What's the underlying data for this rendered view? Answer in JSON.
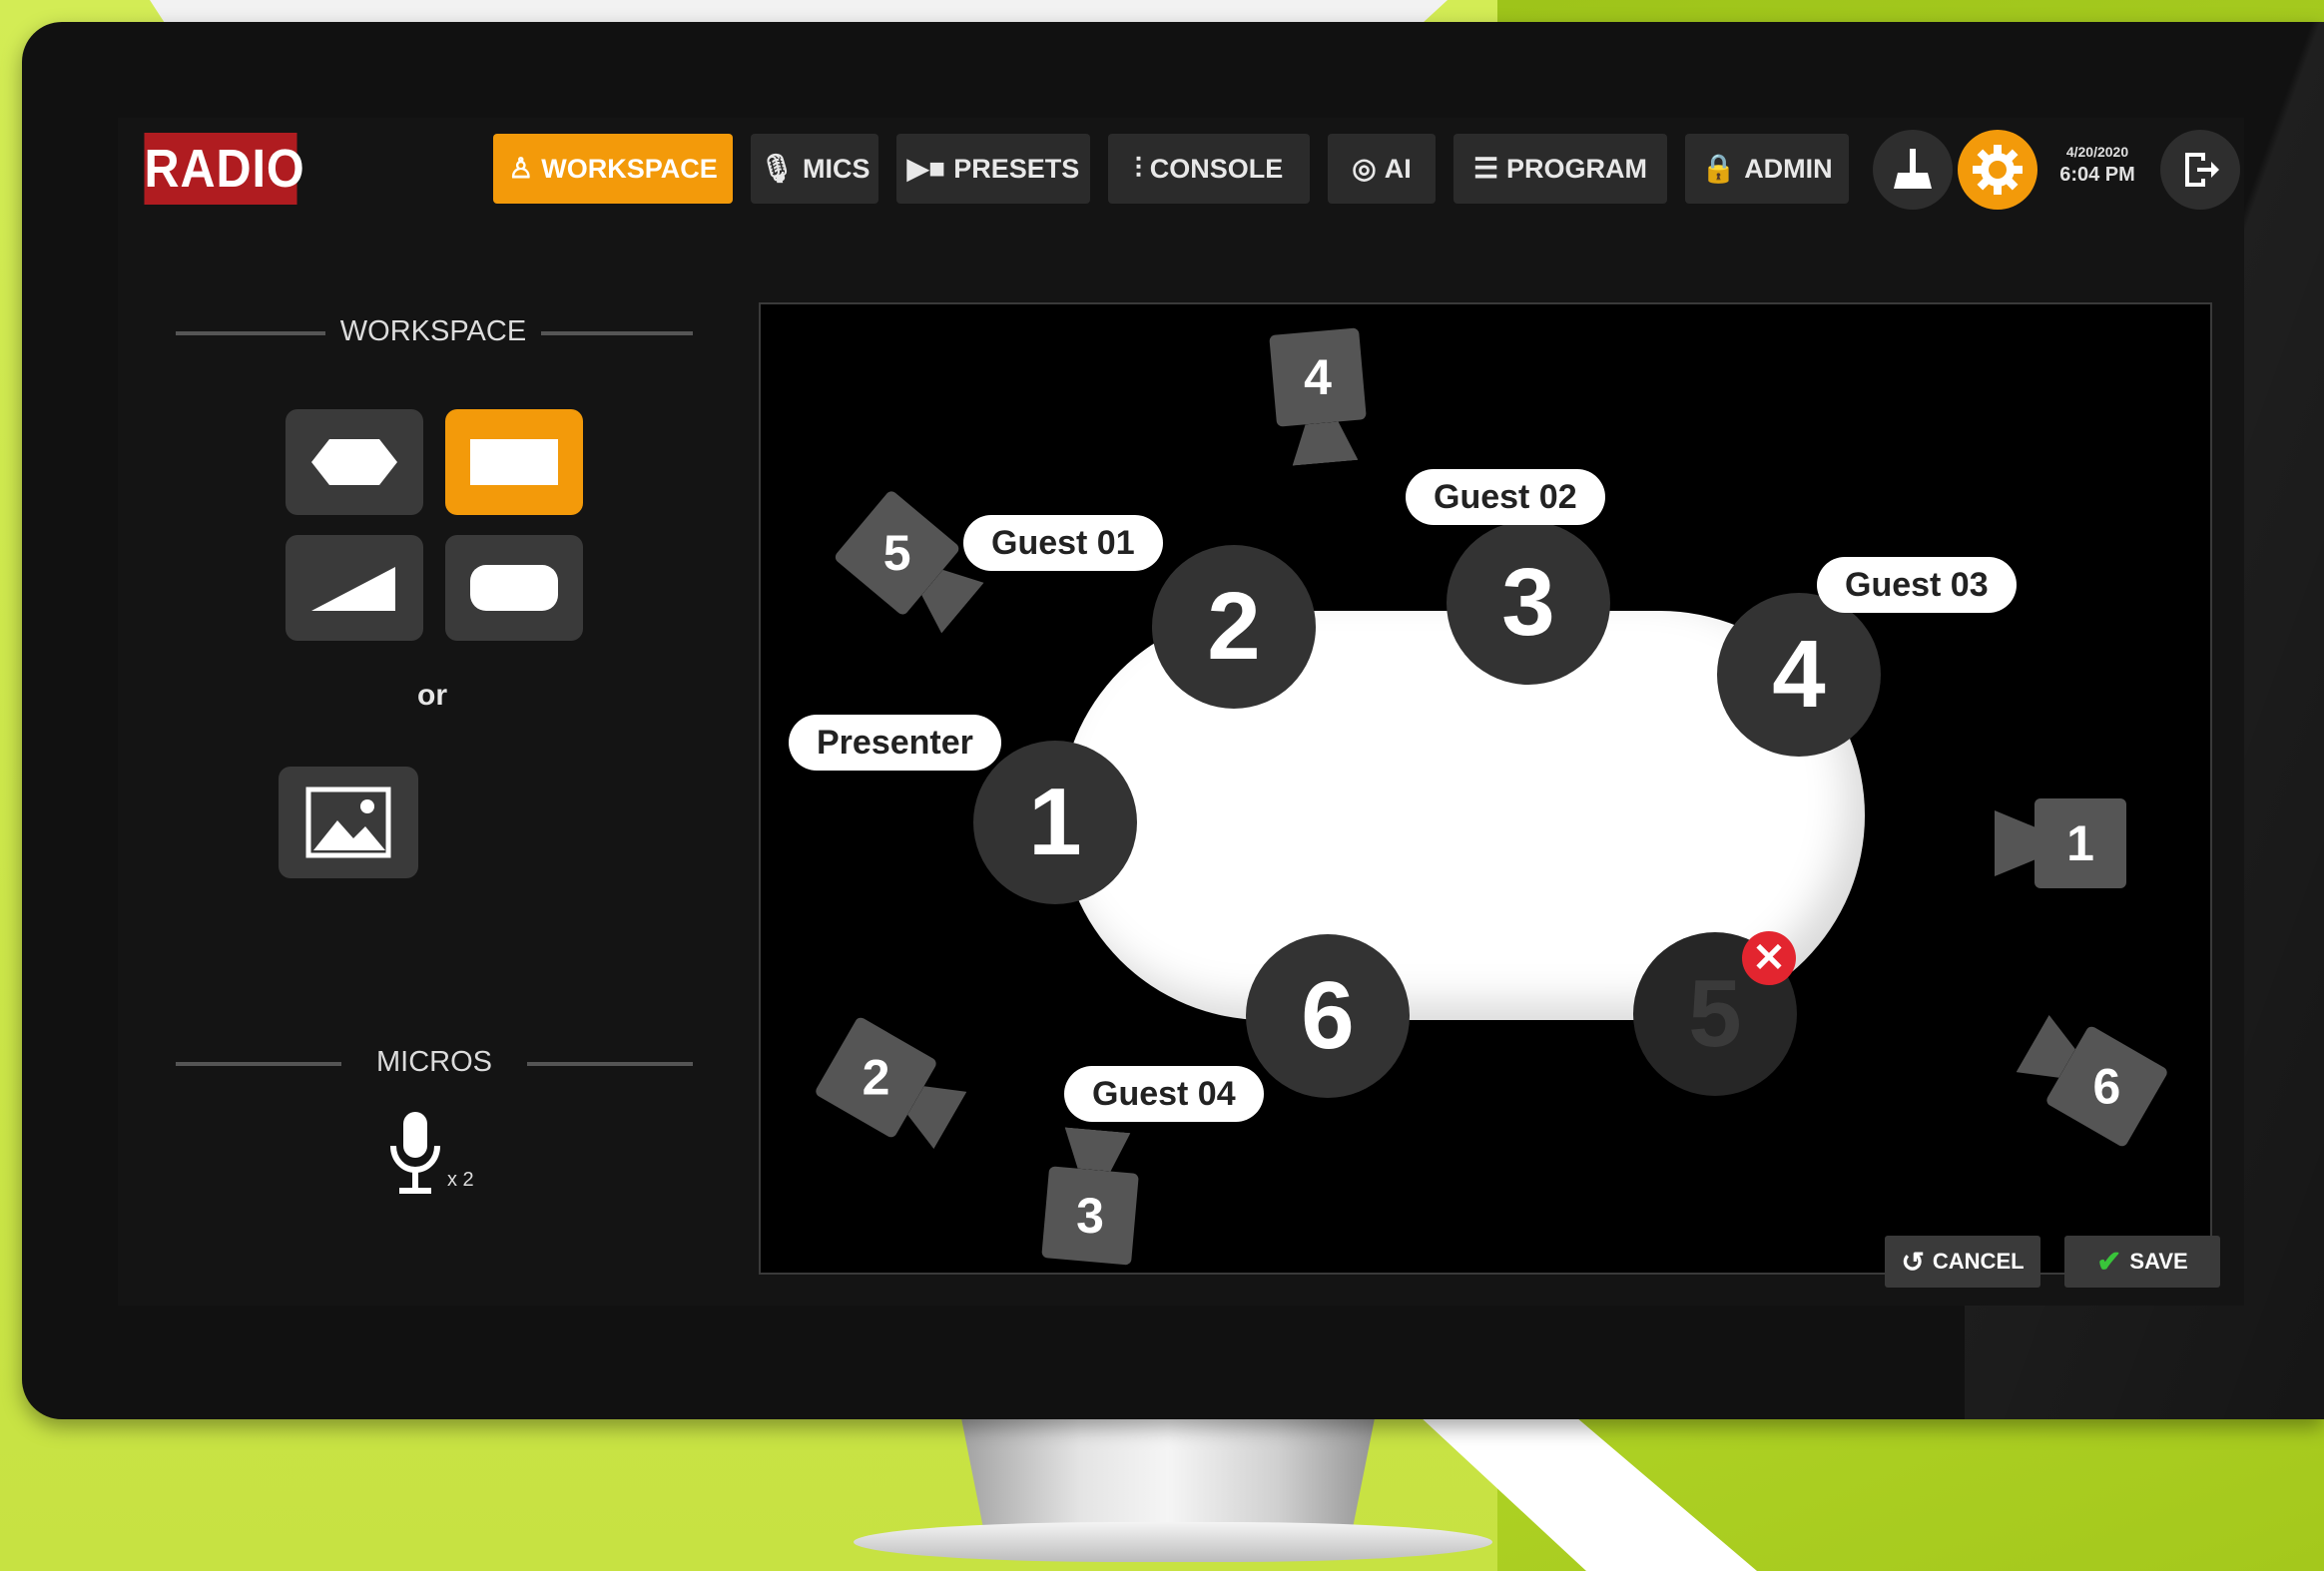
{
  "app": {
    "logo": "RADIO",
    "date": "4/20/2020",
    "time": "6:04 PM"
  },
  "tabs": [
    {
      "label": "WORKSPACE",
      "icon": "person-icon",
      "active": true
    },
    {
      "label": "MICS",
      "icon": "microphone-icon"
    },
    {
      "label": "PRESETS",
      "icon": "video-preset-icon"
    },
    {
      "label": "CONSOLE",
      "icon": "sliders-icon"
    },
    {
      "label": "AI",
      "icon": "brain-icon"
    },
    {
      "label": "PROGRAM",
      "icon": "list-icon"
    },
    {
      "label": "ADMIN",
      "icon": "lock-icon"
    }
  ],
  "toolbar_icons": [
    "broom-icon",
    "gear-icon",
    "logout-icon"
  ],
  "sidebar": {
    "workspace_title": "WORKSPACE",
    "shapes": [
      "hexagon",
      "rectangle",
      "triangle",
      "rounded-rectangle"
    ],
    "selected_shape": "rectangle",
    "or_label": "or",
    "micros_title": "MICROS",
    "mic_count": "x 2"
  },
  "stage": {
    "seats": [
      {
        "number": "1",
        "label": "Presenter"
      },
      {
        "number": "2",
        "label": "Guest 01"
      },
      {
        "number": "3",
        "label": "Guest 02"
      },
      {
        "number": "4",
        "label": "Guest 03"
      },
      {
        "number": "5",
        "label": ""
      },
      {
        "number": "6",
        "label": "Guest 04"
      }
    ],
    "cameras": [
      "1",
      "2",
      "3",
      "4",
      "5",
      "6"
    ]
  },
  "actions": {
    "cancel": "CANCEL",
    "save": "SAVE"
  },
  "colors": {
    "accent": "#f39a0a",
    "brand": "#b01c20",
    "remove": "#e3252f",
    "save_check": "#39c43a"
  }
}
